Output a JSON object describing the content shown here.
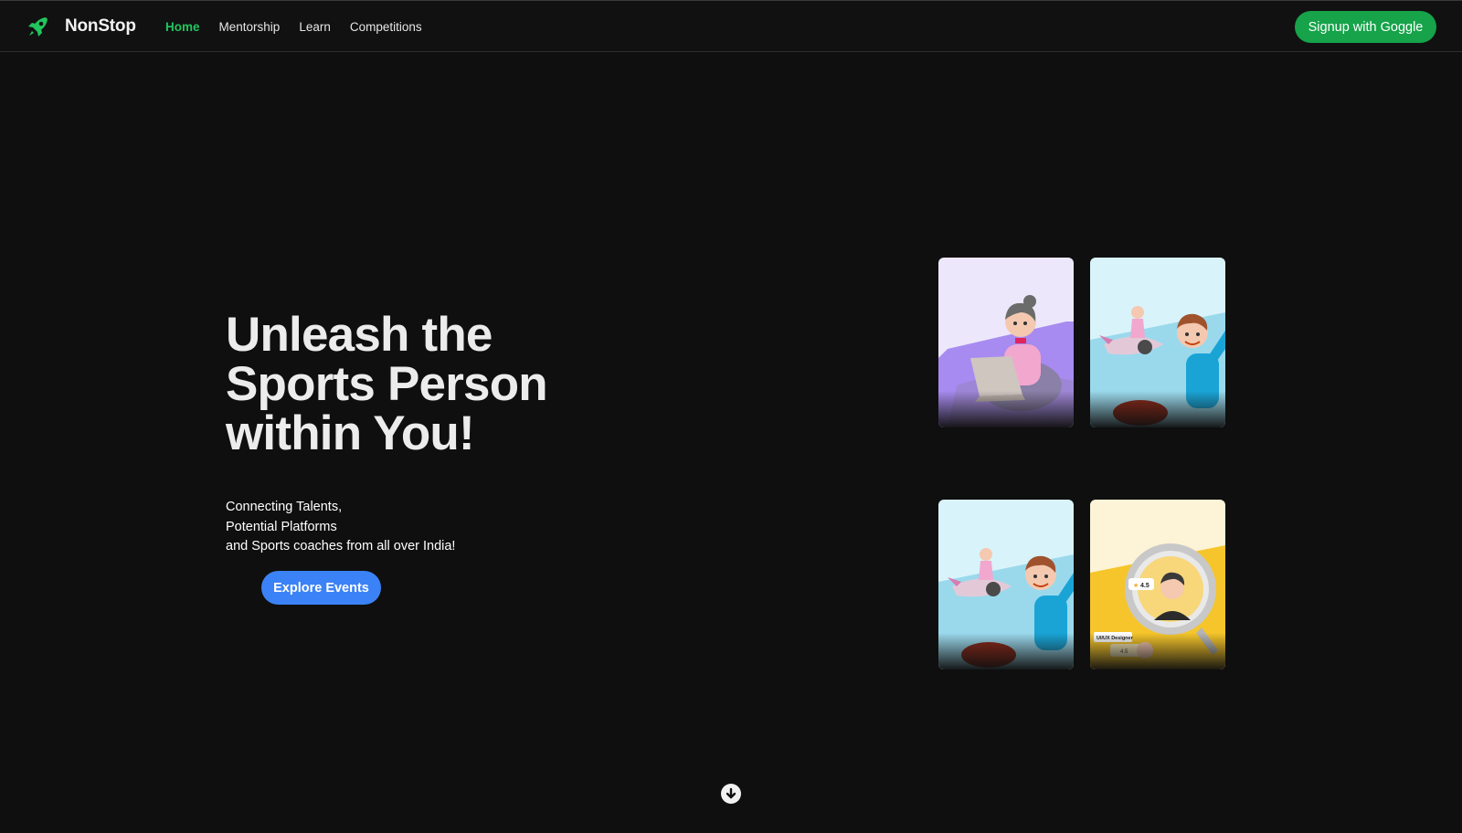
{
  "header": {
    "brand": "NonStop",
    "logo_icon": "rocket-icon",
    "nav": [
      {
        "label": "Home",
        "active": true
      },
      {
        "label": "Mentorship",
        "active": false
      },
      {
        "label": "Learn",
        "active": false
      },
      {
        "label": "Competitions",
        "active": false
      }
    ],
    "signup_label": "Signup with Goggle"
  },
  "hero": {
    "title_lines": [
      "Unleash the",
      "Sports Person",
      "within You!"
    ],
    "subtitle_lines": [
      "Connecting Talents,",
      "Potential Platforms",
      "and Sports coaches from all over India!"
    ],
    "cta_label": "Explore Events"
  },
  "cards": [
    {
      "illustration": "woman-with-laptop"
    },
    {
      "illustration": "boy-with-rocket"
    },
    {
      "illustration": "boy-with-rocket"
    },
    {
      "illustration": "magnifier-profile",
      "rating": "4.5",
      "role": "UI/UX Designer",
      "rating2": "4.5"
    }
  ],
  "scroll_icon": "arrow-down-circle-icon",
  "colors": {
    "background": "#0f0f0f",
    "brand_green": "#16a34a",
    "active_nav": "#22c55e",
    "cta_blue": "#3b82f6"
  }
}
